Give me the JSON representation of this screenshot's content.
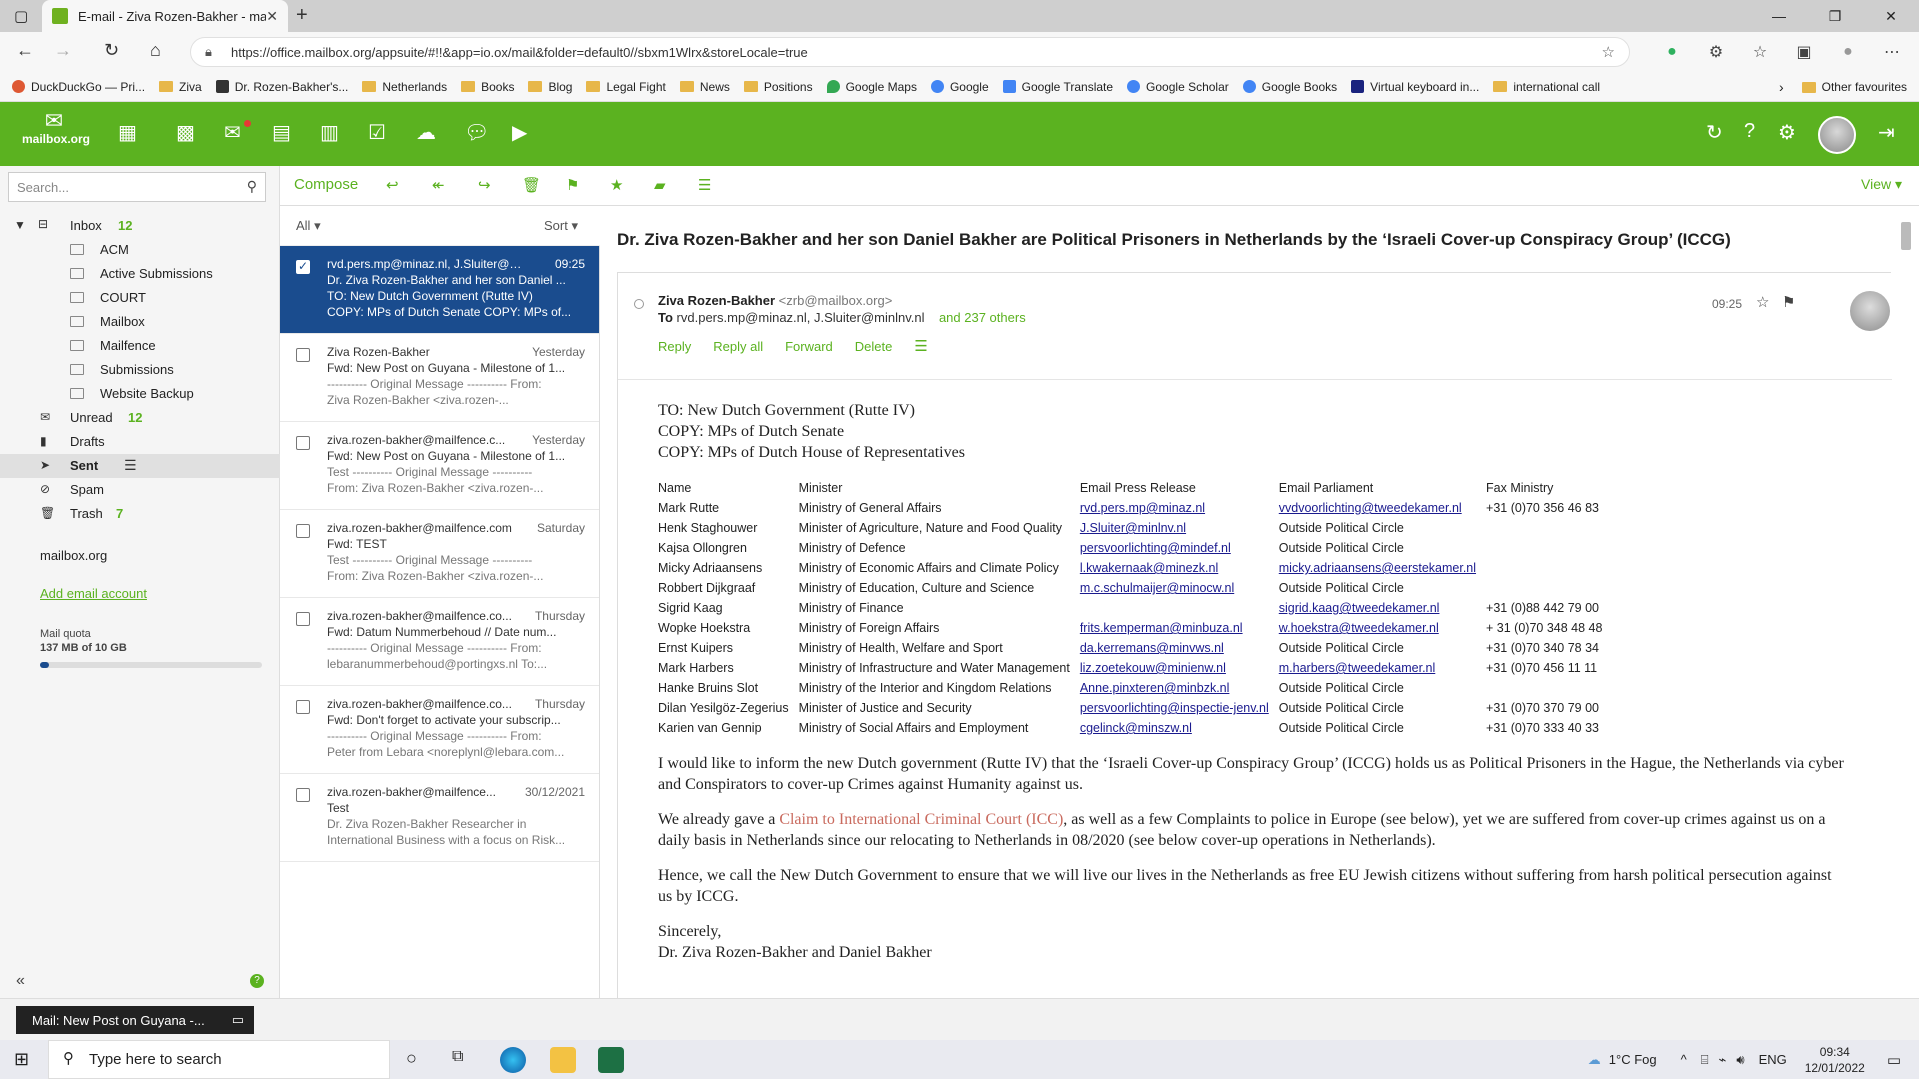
{
  "browser": {
    "tab_title": "E-mail - Ziva Rozen-Bakher - ma",
    "url": "https://office.mailbox.org/appsuite/#!!&app=io.ox/mail&folder=default0//sbxm1Wlrx&storeLocale=true",
    "bookmarks": [
      "DuckDuckGo — Pri...",
      "Ziva",
      "Dr. Rozen-Bakher's...",
      "Netherlands",
      "Books",
      "Blog",
      "Legal Fight",
      "News",
      "Positions",
      "Google Maps",
      "Google",
      "Google Translate",
      "Google Scholar",
      "Google Books",
      "Virtual keyboard in...",
      "international call"
    ],
    "other_favourites": "Other favourites"
  },
  "app": {
    "logo_text": "mailbox.org",
    "search_placeholder": "Search...",
    "toolbar": {
      "compose": "Compose",
      "view": "View"
    }
  },
  "folders": {
    "inbox": {
      "label": "Inbox",
      "count": "12"
    },
    "subfolders": [
      "ACM",
      "Active Submissions",
      "COURT",
      "Mailbox",
      "Mailfence",
      "Submissions",
      "Website Backup"
    ],
    "unread": {
      "label": "Unread",
      "count": "12"
    },
    "drafts": "Drafts",
    "sent": "Sent",
    "spam": "Spam",
    "trash": {
      "label": "Trash",
      "count": "7"
    },
    "account": "mailbox.org",
    "add_account": "Add email account",
    "quota_label": "Mail quota",
    "quota_value": "137 MB of 10 GB",
    "quota_fraction": 0.0137
  },
  "list": {
    "filter": "All",
    "sort": "Sort",
    "items": [
      {
        "from": "rvd.pers.mp@minaz.nl, J.Sluiter@mi...",
        "date": "09:25",
        "l1": "Dr. Ziva Rozen-Bakher and her son Daniel ...",
        "l2": "TO: New Dutch Government (Rutte IV)",
        "l3": "COPY: MPs of Dutch Senate  COPY: MPs of..."
      },
      {
        "from": "Ziva Rozen-Bakher",
        "date": "Yesterday",
        "l1": "Fwd: New Post on Guyana - Milestone of 1...",
        "l2": "---------- Original Message ---------- From:",
        "l3": "Ziva Rozen-Bakher <ziva.rozen-..."
      },
      {
        "from": "ziva.rozen-bakher@mailfence.c...",
        "date": "Yesterday",
        "l1": "Fwd: New Post on Guyana - Milestone of 1...",
        "l2": "Test ---------- Original Message ----------",
        "l3": "From: Ziva Rozen-Bakher <ziva.rozen-..."
      },
      {
        "from": "ziva.rozen-bakher@mailfence.com",
        "date": "Saturday",
        "l1": "Fwd: TEST",
        "l2": "Test ---------- Original Message ----------",
        "l3": "From: Ziva Rozen-Bakher <ziva.rozen-..."
      },
      {
        "from": "ziva.rozen-bakher@mailfence.co...",
        "date": "Thursday",
        "l1": "Fwd: Datum Nummerbehoud // Date num...",
        "l2": "---------- Original Message ---------- From:",
        "l3": "lebaranummerbehoud@portingxs.nl To:..."
      },
      {
        "from": "ziva.rozen-bakher@mailfence.co...",
        "date": "Thursday",
        "l1": "Fwd: Don't forget to activate your subscrip...",
        "l2": "---------- Original Message ---------- From:",
        "l3": "Peter from Lebara <noreplynl@lebara.com..."
      },
      {
        "from": "ziva.rozen-bakher@mailfence...",
        "date": "30/12/2021",
        "l1": "Test",
        "l2": "Dr. Ziva Rozen-Bakher Researcher in",
        "l3": "International Business with a focus on Risk..."
      }
    ]
  },
  "message": {
    "subject": "Dr. Ziva Rozen-Bakher and her son Daniel Bakher are Political Prisoners in Netherlands by the ‘Israeli Cover-up Conspiracy Group’ (ICCG)",
    "sender_name": "Ziva Rozen-Bakher",
    "sender_email": "<zrb@mailbox.org>",
    "to_label": "To",
    "to_list": "rvd.pers.mp@minaz.nl,   J.Sluiter@minlnv.nl",
    "others": "and 237 others",
    "time": "09:25",
    "actions": [
      "Reply",
      "Reply all",
      "Forward",
      "Delete"
    ],
    "heading": [
      "TO: New Dutch Government (Rutte IV)",
      "COPY: MPs of Dutch Senate",
      "COPY: MPs of Dutch House of Representatives"
    ],
    "table_headers": [
      "Name",
      "Minister",
      "Email Press Release",
      "Email Parliament",
      "Fax Ministry"
    ],
    "table_rows": [
      [
        "Mark Rutte",
        "Ministry of General Affairs",
        "rvd.pers.mp@minaz.nl",
        "vvdvoorlichting@tweedekamer.nl",
        "+31 (0)70 356 46 83"
      ],
      [
        "Henk Staghouwer",
        "Minister of Agriculture, Nature and Food Quality",
        "J.Sluiter@minlnv.nl",
        "Outside Political Circle",
        ""
      ],
      [
        "Kajsa Ollongren",
        "Ministry of Defence",
        "persvoorlichting@mindef.nl",
        "Outside Political Circle",
        ""
      ],
      [
        "Micky Adriaansens",
        "Ministry of Economic Affairs and Climate Policy",
        "l.kwakernaak@minezk.nl",
        "micky.adriaansens@eerstekamer.nl",
        ""
      ],
      [
        "Robbert Dijkgraaf",
        "Ministry of Education, Culture and Science",
        "m.c.schulmaijer@minocw.nl",
        "Outside Political Circle",
        ""
      ],
      [
        "Sigrid Kaag",
        "Ministry of Finance",
        "",
        "sigrid.kaag@tweedekamer.nl",
        "+31 (0)88 442 79 00"
      ],
      [
        "Wopke Hoekstra",
        "Ministry of Foreign Affairs",
        "frits.kemperman@minbuza.nl",
        "w.hoekstra@tweedekamer.nl",
        "+ 31 (0)70 348 48 48"
      ],
      [
        "Ernst Kuipers",
        "Ministry of Health, Welfare and Sport",
        "da.kerremans@minvws.nl",
        "Outside Political Circle",
        "+31 (0)70 340 78 34"
      ],
      [
        "Mark Harbers",
        "Ministry of Infrastructure and Water Management",
        "liz.zoetekouw@minienw.nl",
        "m.harbers@tweedekamer.nl",
        "+31 (0)70 456 11 11"
      ],
      [
        "Hanke Bruins Slot",
        "Ministry of the Interior and Kingdom Relations",
        "Anne.pinxteren@minbzk.nl",
        "Outside Political Circle",
        ""
      ],
      [
        "Dilan Yesilgöz-Zegerius",
        "Minister of Justice and Security",
        "persvoorlichting@inspectie-jenv.nl",
        "Outside Political Circle",
        "+31 (0)70 370 79 00"
      ],
      [
        "Karien van Gennip",
        "Ministry of Social Affairs and Employment",
        "cgelinck@minszw.nl",
        "Outside Political Circle",
        "+31 (0)70 333 40 33"
      ]
    ],
    "p1": "I would like to inform the new Dutch government (Rutte IV) that the ‘Israeli Cover-up Conspiracy Group’ (ICCG) holds us as Political Prisoners in the Hague, the Netherlands via cyber and Conspirators to cover-up Crimes against Humanity against us.",
    "p2_a": "We already gave a ",
    "p2_link": "Claim to International Criminal Court (ICC)",
    "p2_b": ", as well as a few Complaints to police in Europe (see below), yet we are suffered from cover-up crimes against us on a daily basis in Netherlands since our relocating to Netherlands in 08/2020 (see below cover-up operations in Netherlands).",
    "p3": "Hence, we call the New Dutch Government to ensure that we will live our lives in the Netherlands as free EU Jewish citizens without suffering from harsh political persecution against us by ICCG.",
    "closing": "Sincerely,",
    "signature": "Dr. Ziva Rozen-Bakher and Daniel Bakher"
  },
  "status": {
    "popup": "Mail: New Post on Guyana -..."
  },
  "taskbar": {
    "search": "Type here to search",
    "weather": "1°C  Fog",
    "lang": "ENG",
    "time": "09:34",
    "date": "12/01/2022"
  },
  "colors": {
    "brand_green": "#5bb220",
    "selected_blue": "#1a4c8e"
  }
}
